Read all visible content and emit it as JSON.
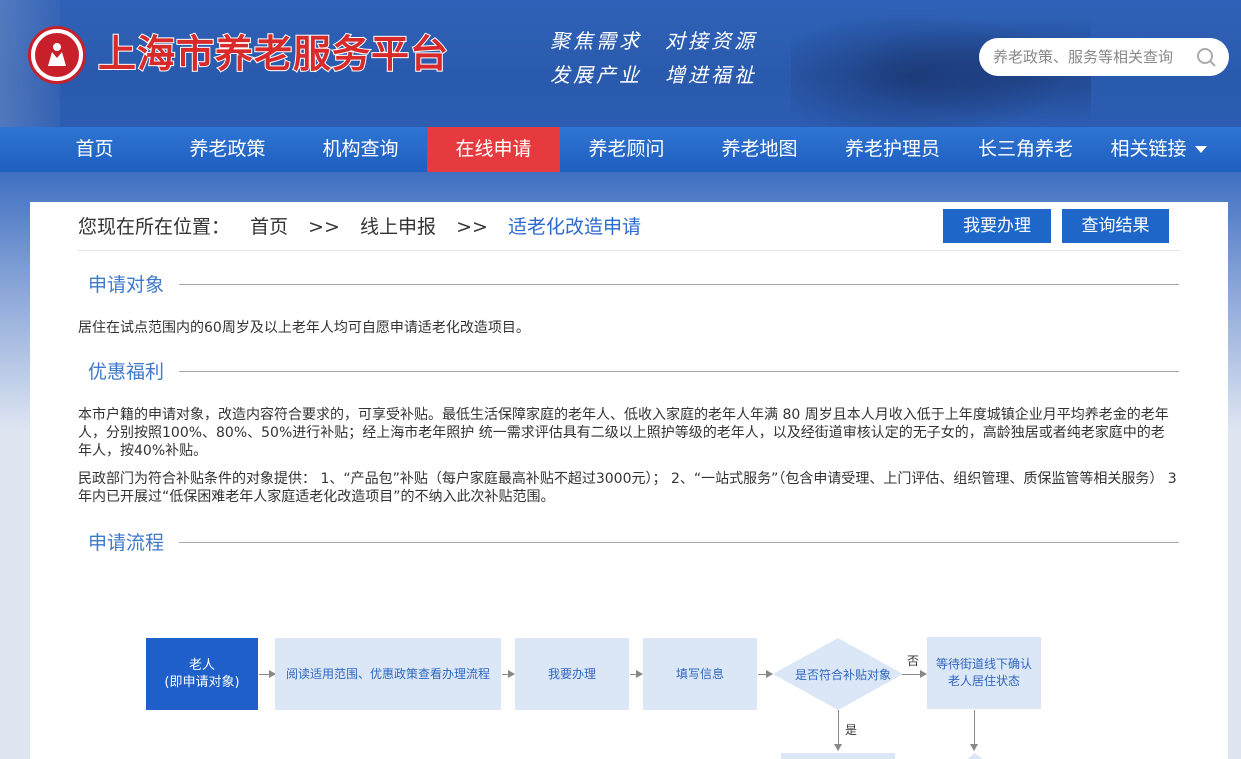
{
  "header": {
    "site_title": "上海市养老服务平台",
    "slogan_line1": "聚焦需求　对接资源",
    "slogan_line2": "发展产业　增进福祉",
    "search_placeholder": "养老政策、服务等相关查询"
  },
  "nav": {
    "items": [
      "首页",
      "养老政策",
      "机构查询",
      "在线申请",
      "养老顾问",
      "养老地图",
      "养老护理员",
      "长三角养老",
      "相关链接"
    ],
    "active_index": 3
  },
  "breadcrumb": {
    "prefix": "您现在所在位置：",
    "home": "首页",
    "sep1": ">>",
    "level2": "线上申报",
    "sep2": ">>",
    "current": "适老化改造申请"
  },
  "actions": {
    "apply_label": "我要办理",
    "query_label": "查询结果"
  },
  "sections": {
    "target": {
      "title": "申请对象",
      "text": "居住在试点范围内的60周岁及以上老年人均可自愿申请适老化改造项目。"
    },
    "benefit": {
      "title": "优惠福利",
      "text1": "本市户籍的申请对象，改造内容符合要求的，可享受补贴。最低生活保障家庭的老年人、低收入家庭的老年人年满 80 周岁且本人月收入低于上年度城镇企业月平均养老金的老年人，分别按照100%、80%、50%进行补贴；经上海市老年照护 统一需求评估具有二级以上照护等级的老年人，以及经街道审核认定的无子女的，高龄独居或者纯老家庭中的老年人，按40%补贴。",
      "text2": "民政部门为符合补贴条件的对象提供： 1、“产品包”补贴（每户家庭最高补贴不超过3000元）； 2、“一站式服务”（包含申请受理、上门评估、组织管理、质保监管等相关服务） 3年内已开展过“低保困难老年人家庭适老化改造项目”的不纳入此次补贴范围。"
    },
    "process": {
      "title": "申请流程"
    }
  },
  "flow": {
    "start_line1": "老人",
    "start_line2": "(即申请对象)",
    "step_read": "阅读适用范围、优惠政策查看办理流程",
    "step_apply": "我要办理",
    "step_fill": "填写信息",
    "decision": "是否符合补贴对象",
    "no_label": "否",
    "yes_label": "是",
    "step_wait": "等待街道线下确认老人居住状态"
  },
  "colors": {
    "header_blue": "#2c5db2",
    "nav_blue": "#1e5fc0",
    "nav_active": "#e63a3f",
    "button_blue": "#1e67c9",
    "section_title": "#3e79cc",
    "flow_light": "#dbe6f6",
    "flow_dark": "#1e5fc9"
  }
}
